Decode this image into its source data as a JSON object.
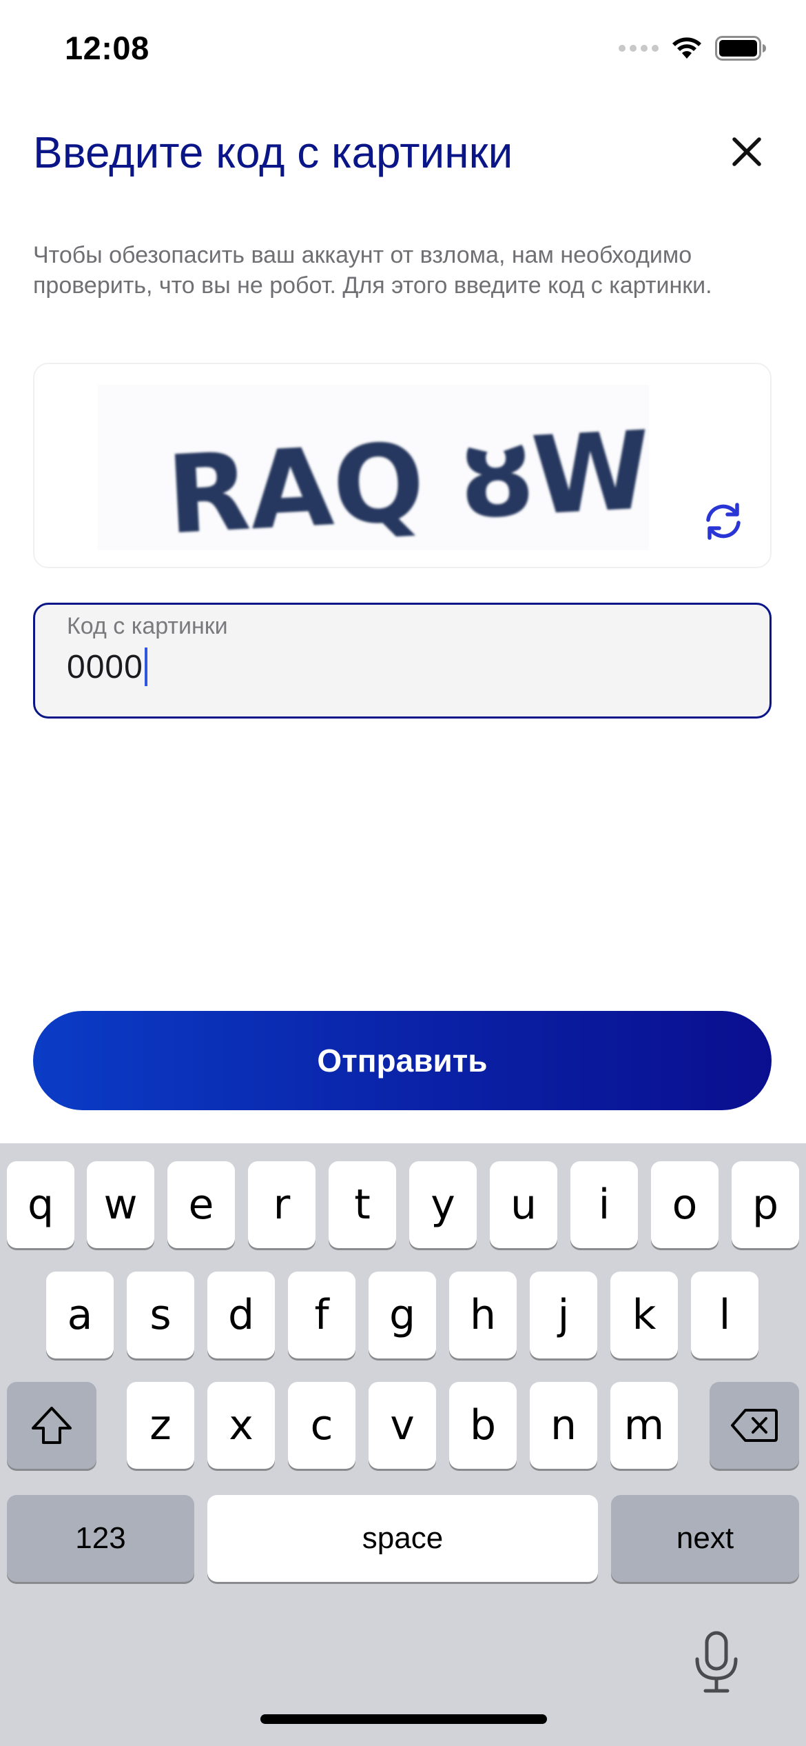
{
  "status_bar": {
    "time": "12:08"
  },
  "header": {
    "title": "Введите код с картинки",
    "close_icon": "close-icon"
  },
  "description": "Чтобы обезопасить ваш аккаунт от взлома, нам необходимо проверить, что вы не робот. Для этого введите код с картинки.",
  "captcha": {
    "text": "RAQ ȣW",
    "refresh_icon": "refresh-icon"
  },
  "code_input": {
    "label": "Код с картинки",
    "value": "0000"
  },
  "submit_button": {
    "label": "Отправить"
  },
  "keyboard": {
    "row1": [
      "q",
      "w",
      "e",
      "r",
      "t",
      "y",
      "u",
      "i",
      "o",
      "p"
    ],
    "row2": [
      "a",
      "s",
      "d",
      "f",
      "g",
      "h",
      "j",
      "k",
      "l"
    ],
    "row3": [
      "z",
      "x",
      "c",
      "v",
      "b",
      "n",
      "m"
    ],
    "numbers_key": "123",
    "space_key": "space",
    "next_key": "next"
  },
  "colors": {
    "accent": "#0a1687",
    "button_gradient_start": "#0b3cc6",
    "button_gradient_end": "#0a0f8f",
    "refresh": "#2a35d6"
  }
}
